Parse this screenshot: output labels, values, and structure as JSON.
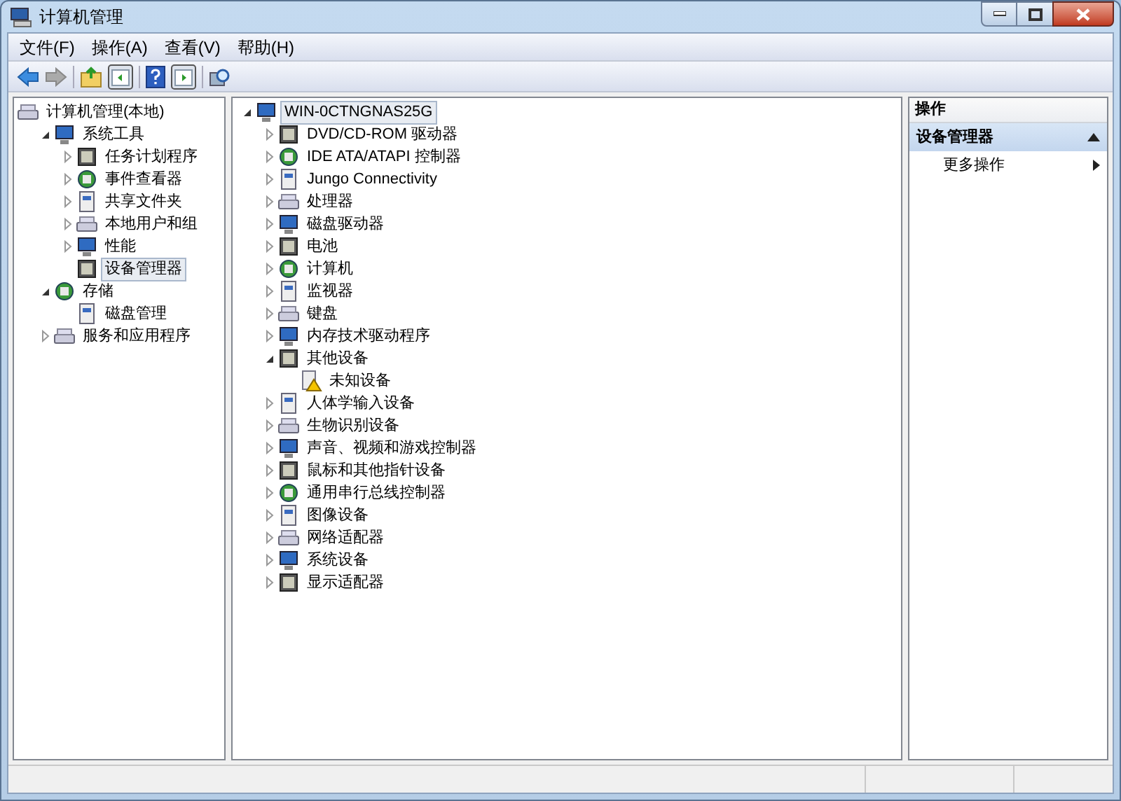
{
  "window": {
    "title": "计算机管理"
  },
  "menu": [
    "文件(F)",
    "操作(A)",
    "查看(V)",
    "帮助(H)"
  ],
  "left_tree": [
    {
      "label": "计算机管理(本地)",
      "selected": false,
      "children": [
        {
          "label": "系统工具",
          "expanded": true,
          "selected": false,
          "children": [
            {
              "label": "任务计划程序",
              "expanded": false,
              "selected": false
            },
            {
              "label": "事件查看器",
              "expanded": false,
              "selected": false
            },
            {
              "label": "共享文件夹",
              "expanded": false,
              "selected": false
            },
            {
              "label": "本地用户和组",
              "expanded": false,
              "selected": false
            },
            {
              "label": "性能",
              "expanded": false,
              "selected": false
            },
            {
              "label": "设备管理器",
              "selected": true
            }
          ]
        },
        {
          "label": "存储",
          "expanded": true,
          "selected": false,
          "children": [
            {
              "label": "磁盘管理",
              "selected": false
            }
          ]
        },
        {
          "label": "服务和应用程序",
          "expanded": false,
          "selected": false
        }
      ]
    }
  ],
  "device_tree": [
    {
      "label": "WIN-0CTNGNAS25G",
      "expanded": true,
      "selected": true,
      "children": [
        {
          "label": "DVD/CD-ROM 驱动器",
          "expanded": false,
          "selected": false
        },
        {
          "label": "IDE ATA/ATAPI 控制器",
          "expanded": false,
          "selected": false
        },
        {
          "label": "Jungo Connectivity",
          "expanded": false,
          "selected": false
        },
        {
          "label": "处理器",
          "expanded": false,
          "selected": false
        },
        {
          "label": "磁盘驱动器",
          "expanded": false,
          "selected": false
        },
        {
          "label": "电池",
          "expanded": false,
          "selected": false
        },
        {
          "label": "计算机",
          "expanded": false,
          "selected": false
        },
        {
          "label": "监视器",
          "expanded": false,
          "selected": false
        },
        {
          "label": "键盘",
          "expanded": false,
          "selected": false
        },
        {
          "label": "内存技术驱动程序",
          "expanded": false,
          "selected": false
        },
        {
          "label": "其他设备",
          "expanded": true,
          "selected": false,
          "children": [
            {
              "label": "未知设备",
              "selected": false,
              "warning": true
            }
          ]
        },
        {
          "label": "人体学输入设备",
          "expanded": false,
          "selected": false
        },
        {
          "label": "生物识别设备",
          "expanded": false,
          "selected": false
        },
        {
          "label": "声音、视频和游戏控制器",
          "expanded": false,
          "selected": false
        },
        {
          "label": "鼠标和其他指针设备",
          "expanded": false,
          "selected": false
        },
        {
          "label": "通用串行总线控制器",
          "expanded": false,
          "selected": false
        },
        {
          "label": "图像设备",
          "expanded": false,
          "selected": false
        },
        {
          "label": "网络适配器",
          "expanded": false,
          "selected": false
        },
        {
          "label": "系统设备",
          "expanded": false,
          "selected": false
        },
        {
          "label": "显示适配器",
          "expanded": false,
          "selected": false
        }
      ]
    }
  ],
  "actions": {
    "header": "操作",
    "section": {
      "label": "设备管理器",
      "expanded": true
    },
    "items": [
      "更多操作"
    ]
  }
}
